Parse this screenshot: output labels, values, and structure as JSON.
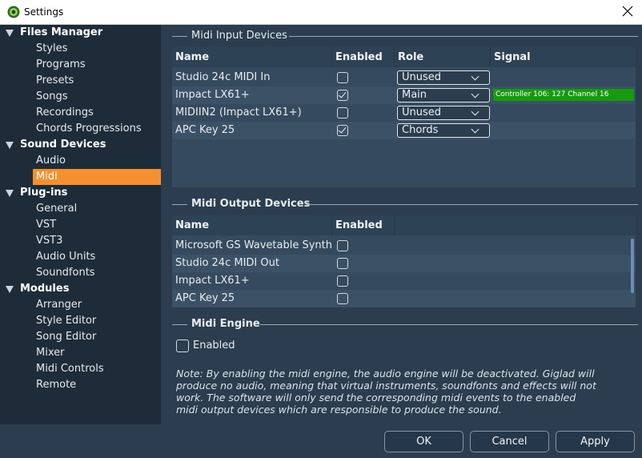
{
  "window": {
    "title": "Settings"
  },
  "sidebar": {
    "categories": [
      {
        "label": "Files Manager",
        "items": [
          "Styles",
          "Programs",
          "Presets",
          "Songs",
          "Recordings",
          "Chords Progressions"
        ]
      },
      {
        "label": "Sound Devices",
        "items": [
          "Audio",
          "Midi"
        ]
      },
      {
        "label": "Plug-ins",
        "items": [
          "General",
          "VST",
          "VST3",
          "Audio Units",
          "Soundfonts"
        ]
      },
      {
        "label": "Modules",
        "items": [
          "Arranger",
          "Style Editor",
          "Song Editor",
          "Mixer",
          "Midi Controls",
          "Remote"
        ]
      }
    ],
    "selected": "Midi"
  },
  "midi_input": {
    "title": "Midi Input Devices",
    "columns": [
      "Name",
      "Enabled",
      "Role",
      "Signal"
    ],
    "rows": [
      {
        "name": "Studio 24c MIDI In",
        "enabled": false,
        "role": "Unused",
        "signal": ""
      },
      {
        "name": "Impact LX61+",
        "enabled": true,
        "role": "Main",
        "signal": "Controller 106: 127 Channel 16"
      },
      {
        "name": "MIDIIN2 (Impact LX61+)",
        "enabled": false,
        "role": "Unused",
        "signal": ""
      },
      {
        "name": "APC Key 25",
        "enabled": true,
        "role": "Chords",
        "signal": ""
      }
    ]
  },
  "midi_output": {
    "title": "Midi Output Devices",
    "columns": [
      "Name",
      "Enabled"
    ],
    "rows": [
      {
        "name": "Microsoft GS Wavetable Synth",
        "enabled": false
      },
      {
        "name": "Studio 24c MIDI Out",
        "enabled": false
      },
      {
        "name": "Impact LX61+",
        "enabled": false
      },
      {
        "name": "APC Key 25",
        "enabled": false
      }
    ]
  },
  "midi_engine": {
    "title": "Midi Engine",
    "enabled_label": "Enabled",
    "enabled": false,
    "note": "Note: By enabling the midi engine, the audio engine will be deactivated. Giglad will produce no audio, meaning that virtual instruments, soundfonts and effects will not work. The software will only send the corresponding midi events to the enabled midi output devices which are responsible to produce the sound."
  },
  "buttons": {
    "ok": "OK",
    "cancel": "Cancel",
    "apply": "Apply"
  },
  "colors": {
    "selected": "#f4902f",
    "signal": "#179a0f",
    "sidebar": "#1e2c39",
    "panel": "#2b3d4f"
  }
}
